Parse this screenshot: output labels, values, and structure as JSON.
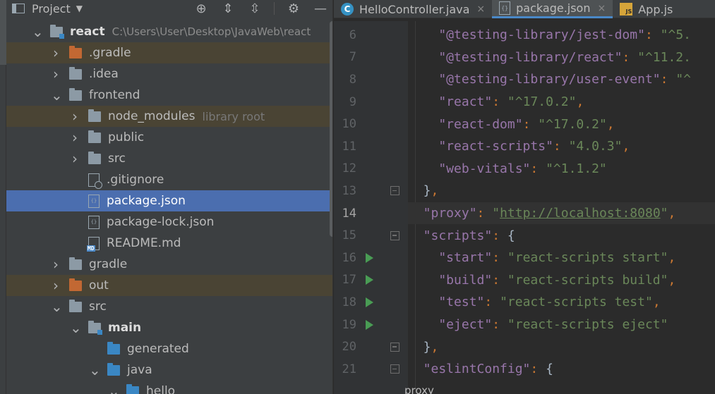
{
  "project": {
    "title": "Project",
    "tree": [
      {
        "name": "react",
        "path": "C:\\Users\\User\\Desktop\\JavaWeb\\react",
        "bold": true,
        "indent": 0,
        "arrow": "down",
        "icon": "folder-module"
      },
      {
        "name": ".gradle",
        "indent": 1,
        "arrow": "right",
        "icon": "folder-orange",
        "excluded": true
      },
      {
        "name": ".idea",
        "indent": 1,
        "arrow": "right",
        "icon": "folder"
      },
      {
        "name": "frontend",
        "indent": 1,
        "arrow": "down",
        "icon": "folder"
      },
      {
        "name": "node_modules",
        "hint": "library root",
        "indent": 2,
        "arrow": "right",
        "icon": "folder",
        "excluded": true
      },
      {
        "name": "public",
        "indent": 2,
        "arrow": "right",
        "icon": "folder"
      },
      {
        "name": "src",
        "indent": 2,
        "arrow": "right",
        "icon": "folder"
      },
      {
        "name": ".gitignore",
        "indent": 2,
        "arrow": "none",
        "icon": "file-git"
      },
      {
        "name": "package.json",
        "indent": 2,
        "arrow": "none",
        "icon": "file-json",
        "selected": true
      },
      {
        "name": "package-lock.json",
        "indent": 2,
        "arrow": "none",
        "icon": "file-json"
      },
      {
        "name": "README.md",
        "indent": 2,
        "arrow": "none",
        "icon": "file-md"
      },
      {
        "name": "gradle",
        "indent": 1,
        "arrow": "right",
        "icon": "folder"
      },
      {
        "name": "out",
        "indent": 1,
        "arrow": "right",
        "icon": "folder-orange",
        "excluded": true
      },
      {
        "name": "src",
        "indent": 1,
        "arrow": "down",
        "icon": "folder"
      },
      {
        "name": "main",
        "bold": true,
        "indent": 2,
        "arrow": "down",
        "icon": "folder-module"
      },
      {
        "name": "generated",
        "indent": 3,
        "arrow": "none",
        "icon": "folder-generated"
      },
      {
        "name": "java",
        "indent": 3,
        "arrow": "down",
        "icon": "folder-blue"
      },
      {
        "name": "hello",
        "indent": 4,
        "arrow": "down",
        "icon": "folder-package"
      }
    ]
  },
  "tabs": [
    {
      "label": "HelloController.java",
      "icon": "class-icon",
      "active": false
    },
    {
      "label": "package.json",
      "icon": "json-icon",
      "active": true
    },
    {
      "label": "App.js",
      "icon": "js-icon",
      "active": false
    }
  ],
  "editor": {
    "lines": [
      {
        "n": "6",
        "run": false,
        "fold": false,
        "tokens": [
          [
            "k",
            "    \"@testing-library/jest-dom\""
          ],
          [
            "p",
            ": "
          ],
          [
            "s",
            "\"^5."
          ]
        ]
      },
      {
        "n": "7",
        "run": false,
        "fold": false,
        "tokens": [
          [
            "k",
            "    \"@testing-library/react\""
          ],
          [
            "p",
            ": "
          ],
          [
            "s",
            "\"^11.2."
          ]
        ]
      },
      {
        "n": "8",
        "run": false,
        "fold": false,
        "tokens": [
          [
            "k",
            "    \"@testing-library/user-event\""
          ],
          [
            "p",
            ": "
          ],
          [
            "s",
            "\"^"
          ]
        ]
      },
      {
        "n": "9",
        "run": false,
        "fold": false,
        "tokens": [
          [
            "k",
            "    \"react\""
          ],
          [
            "p",
            ": "
          ],
          [
            "s",
            "\"^17.0.2\""
          ],
          [
            "p",
            ","
          ]
        ]
      },
      {
        "n": "10",
        "run": false,
        "fold": false,
        "tokens": [
          [
            "k",
            "    \"react-dom\""
          ],
          [
            "p",
            ": "
          ],
          [
            "s",
            "\"^17.0.2\""
          ],
          [
            "p",
            ","
          ]
        ]
      },
      {
        "n": "11",
        "run": false,
        "fold": false,
        "tokens": [
          [
            "k",
            "    \"react-scripts\""
          ],
          [
            "p",
            ": "
          ],
          [
            "s",
            "\"4.0.3\""
          ],
          [
            "p",
            ","
          ]
        ]
      },
      {
        "n": "12",
        "run": false,
        "fold": false,
        "tokens": [
          [
            "k",
            "    \"web-vitals\""
          ],
          [
            "p",
            ": "
          ],
          [
            "s",
            "\"^1.1.2\""
          ]
        ]
      },
      {
        "n": "13",
        "run": false,
        "fold": true,
        "tokens": [
          [
            "t",
            "  }"
          ],
          [
            "p",
            ","
          ]
        ]
      },
      {
        "n": "14",
        "run": false,
        "fold": false,
        "current": true,
        "tokens": [
          [
            "k",
            "  \"proxy\""
          ],
          [
            "p",
            ": "
          ],
          [
            "s",
            "\""
          ],
          [
            "u",
            "http://localhost:8080"
          ],
          [
            "s",
            "\""
          ],
          [
            "p",
            ","
          ]
        ]
      },
      {
        "n": "15",
        "run": false,
        "fold": true,
        "tokens": [
          [
            "k",
            "  \"scripts\""
          ],
          [
            "p",
            ": "
          ],
          [
            "t",
            "{"
          ]
        ]
      },
      {
        "n": "16",
        "run": true,
        "fold": false,
        "tokens": [
          [
            "k",
            "    \"start\""
          ],
          [
            "p",
            ": "
          ],
          [
            "s",
            "\"react-scripts start\""
          ],
          [
            "p",
            ","
          ]
        ]
      },
      {
        "n": "17",
        "run": true,
        "fold": false,
        "tokens": [
          [
            "k",
            "    \"build\""
          ],
          [
            "p",
            ": "
          ],
          [
            "s",
            "\"react-scripts build\""
          ],
          [
            "p",
            ","
          ]
        ]
      },
      {
        "n": "18",
        "run": true,
        "fold": false,
        "tokens": [
          [
            "k",
            "    \"test\""
          ],
          [
            "p",
            ": "
          ],
          [
            "s",
            "\"react-scripts test\""
          ],
          [
            "p",
            ","
          ]
        ]
      },
      {
        "n": "19",
        "run": true,
        "fold": false,
        "tokens": [
          [
            "k",
            "    \"eject\""
          ],
          [
            "p",
            ": "
          ],
          [
            "s",
            "\"react-scripts eject\""
          ]
        ]
      },
      {
        "n": "20",
        "run": false,
        "fold": true,
        "tokens": [
          [
            "t",
            "  }"
          ],
          [
            "p",
            ","
          ]
        ]
      },
      {
        "n": "21",
        "run": false,
        "fold": true,
        "tokens": [
          [
            "k",
            "  \"eslintConfig\""
          ],
          [
            "p",
            ": "
          ],
          [
            "t",
            "{"
          ]
        ]
      }
    ],
    "breadcrumb": "proxy"
  }
}
